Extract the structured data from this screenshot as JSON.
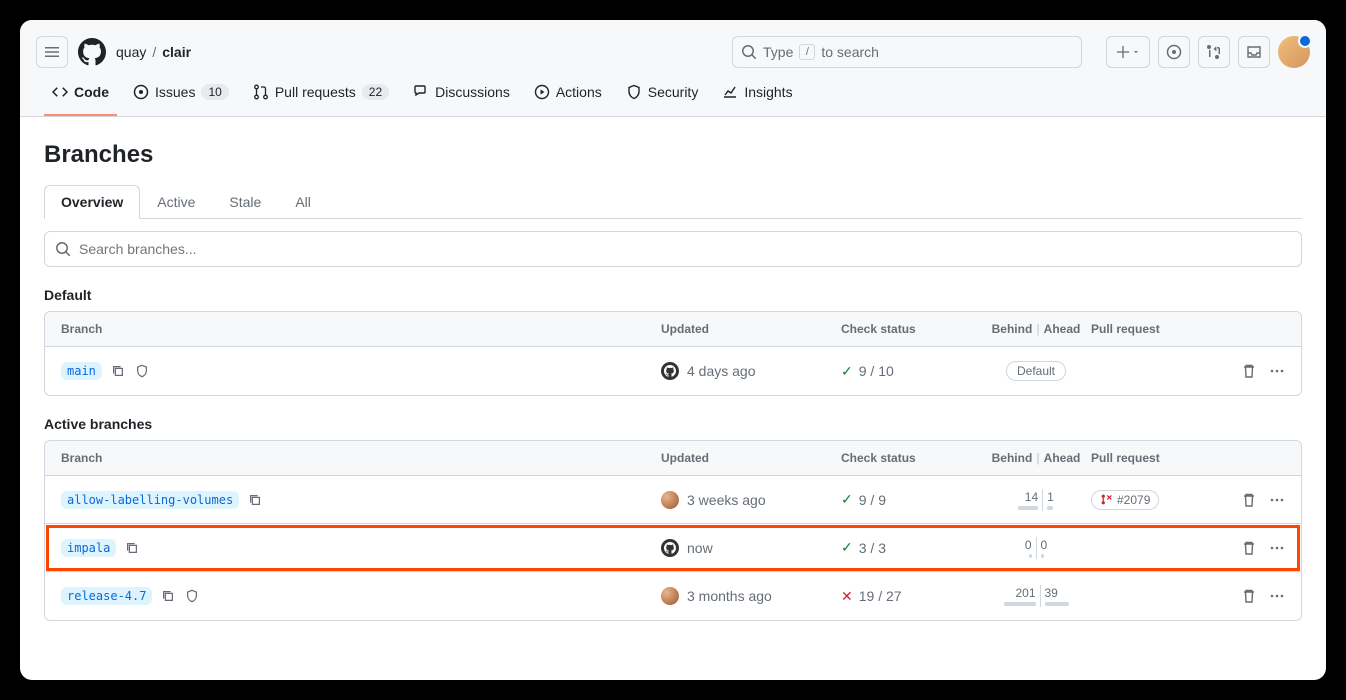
{
  "breadcrumb": {
    "owner": "quay",
    "repo": "clair"
  },
  "search": {
    "placeholder_pre": "Type",
    "placeholder_key": "/",
    "placeholder_post": "to search"
  },
  "repo_tabs": {
    "code": "Code",
    "issues": "Issues",
    "issues_count": "10",
    "pulls": "Pull requests",
    "pulls_count": "22",
    "discussions": "Discussions",
    "actions": "Actions",
    "security": "Security",
    "insights": "Insights"
  },
  "page_title": "Branches",
  "branch_tabs": {
    "overview": "Overview",
    "active": "Active",
    "stale": "Stale",
    "all": "All"
  },
  "branch_search": {
    "placeholder": "Search branches..."
  },
  "columns": {
    "branch": "Branch",
    "updated": "Updated",
    "check": "Check status",
    "behind": "Behind",
    "ahead": "Ahead",
    "pr": "Pull request"
  },
  "sections": {
    "default": "Default",
    "active": "Active branches"
  },
  "default_branch": {
    "name": "main",
    "updated": "4 days ago",
    "check": "9 / 10",
    "check_state": "ok",
    "badge": "Default",
    "author_type": "gh"
  },
  "active_branches": [
    {
      "name": "allow-labelling-volumes",
      "updated": "3 weeks ago",
      "check": "9 / 9",
      "check_state": "ok",
      "behind": "14",
      "ahead": "1",
      "behind_w": 20,
      "ahead_w": 6,
      "pr": "#2079",
      "author_type": "user",
      "highlight": false,
      "protected": false
    },
    {
      "name": "impala",
      "updated": "now",
      "check": "3 / 3",
      "check_state": "ok",
      "behind": "0",
      "ahead": "0",
      "behind_w": 3,
      "ahead_w": 3,
      "pr": "",
      "author_type": "gh",
      "highlight": true,
      "protected": false
    },
    {
      "name": "release-4.7",
      "updated": "3 months ago",
      "check": "19 / 27",
      "check_state": "fail",
      "behind": "201",
      "ahead": "39",
      "behind_w": 32,
      "ahead_w": 24,
      "pr": "",
      "author_type": "user",
      "highlight": false,
      "protected": true
    }
  ]
}
